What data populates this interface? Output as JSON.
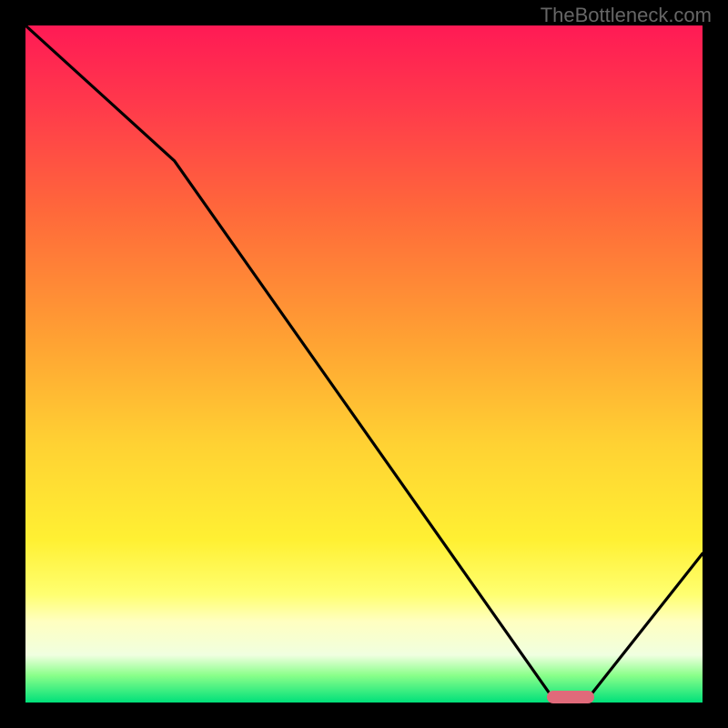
{
  "watermark": "TheBottleneck.com",
  "chart_data": {
    "type": "line",
    "title": "",
    "xlabel": "",
    "ylabel": "",
    "xlim": [
      0,
      100
    ],
    "ylim": [
      0,
      100
    ],
    "x": [
      0,
      22,
      78,
      83,
      100
    ],
    "values": [
      100,
      80,
      0.5,
      0.5,
      22
    ],
    "marker": {
      "x_start": 77,
      "x_end": 84,
      "y": 0.8
    },
    "background": "vertical-gradient red→orange→yellow→green",
    "grid": false,
    "legend": false,
    "note": "Values are percentages of the plotting area; no numeric axis labels are visible in the image."
  },
  "colors": {
    "frame": "#000000",
    "curve": "#000000",
    "marker": "#e06a7a"
  }
}
